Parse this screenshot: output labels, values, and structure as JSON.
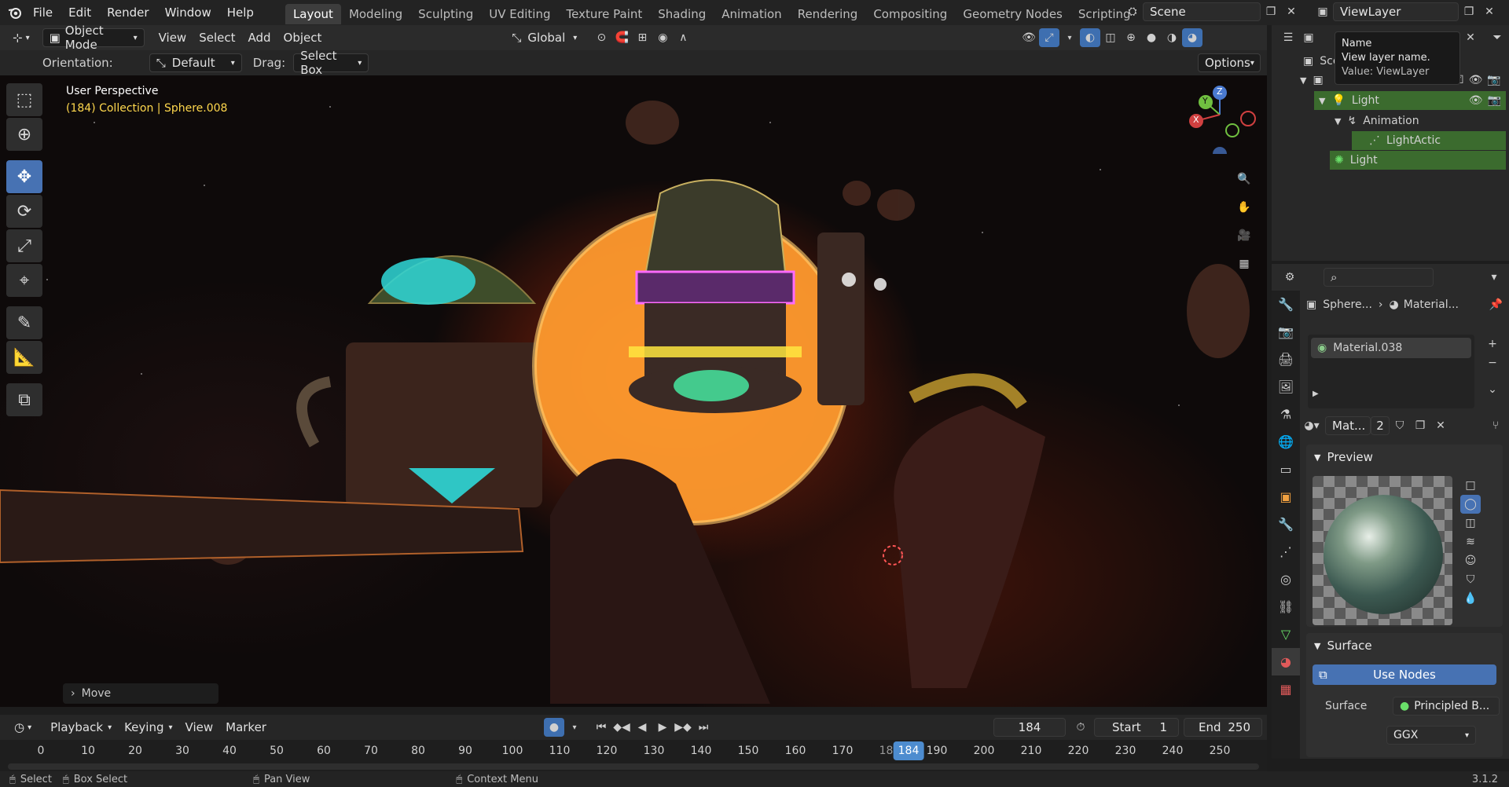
{
  "menu": [
    "File",
    "Edit",
    "Render",
    "Window",
    "Help"
  ],
  "workspaces": [
    "Layout",
    "Modeling",
    "Sculpting",
    "UV Editing",
    "Texture Paint",
    "Shading",
    "Animation",
    "Rendering",
    "Compositing",
    "Geometry Nodes",
    "Scripting"
  ],
  "active_workspace": "Layout",
  "scene_name": "Scene",
  "view_layer": "ViewLayer",
  "header": {
    "mode": "Object Mode",
    "view": "View",
    "select": "Select",
    "add": "Add",
    "object": "Object",
    "transform_orientation": "Global"
  },
  "tool_settings": {
    "orientation_label": "Orientation:",
    "orientation_value": "Default",
    "drag_label": "Drag:",
    "drag_value": "Select Box",
    "options": "Options"
  },
  "viewport": {
    "perspective": "User Perspective",
    "collection_info": "(184) Collection | Sphere.008",
    "last_op": "Move",
    "gizmo_axes": [
      "Z",
      "Y",
      "X"
    ]
  },
  "tooltip": {
    "title": "Name",
    "desc": "View layer name.",
    "value": "Value: ViewLayer"
  },
  "outliner": {
    "scene_row": "Sce",
    "items": [
      {
        "label": "Light",
        "level": 0
      },
      {
        "label": "Animation",
        "level": 1
      },
      {
        "label": "LightActic",
        "level": 2
      },
      {
        "label": "Light",
        "level": 1
      }
    ]
  },
  "properties": {
    "breadcrumb_object": "Sphere...",
    "breadcrumb_material": "Material...",
    "material_slot": "Material.038",
    "datablock_name": "Mat...",
    "user_count": "2",
    "preview_label": "Preview",
    "surface_label": "Surface",
    "use_nodes": "Use Nodes",
    "surface_field_label": "Surface",
    "surface_field_value": "Principled B...",
    "distribution": "GGX"
  },
  "timeline": {
    "playback": "Playback",
    "keying": "Keying",
    "view": "View",
    "marker": "Marker",
    "current_frame": "184",
    "start_label": "Start",
    "start_value": "1",
    "end_label": "End",
    "end_value": "250",
    "ticks": [
      "0",
      "10",
      "20",
      "30",
      "40",
      "50",
      "60",
      "70",
      "80",
      "90",
      "100",
      "110",
      "120",
      "130",
      "140",
      "150",
      "160",
      "170",
      "180",
      "190",
      "200",
      "210",
      "220",
      "230",
      "240",
      "250"
    ]
  },
  "status": {
    "select": "Select",
    "box_select": "Box Select",
    "pan_view": "Pan View",
    "context_menu": "Context Menu",
    "version": "3.1.2"
  },
  "colors": {
    "accent": "#4772b3",
    "selected_row": "#3b6b2e",
    "frame_indicator": "#4d8ccf",
    "info_yellow": "#ffd84d"
  }
}
